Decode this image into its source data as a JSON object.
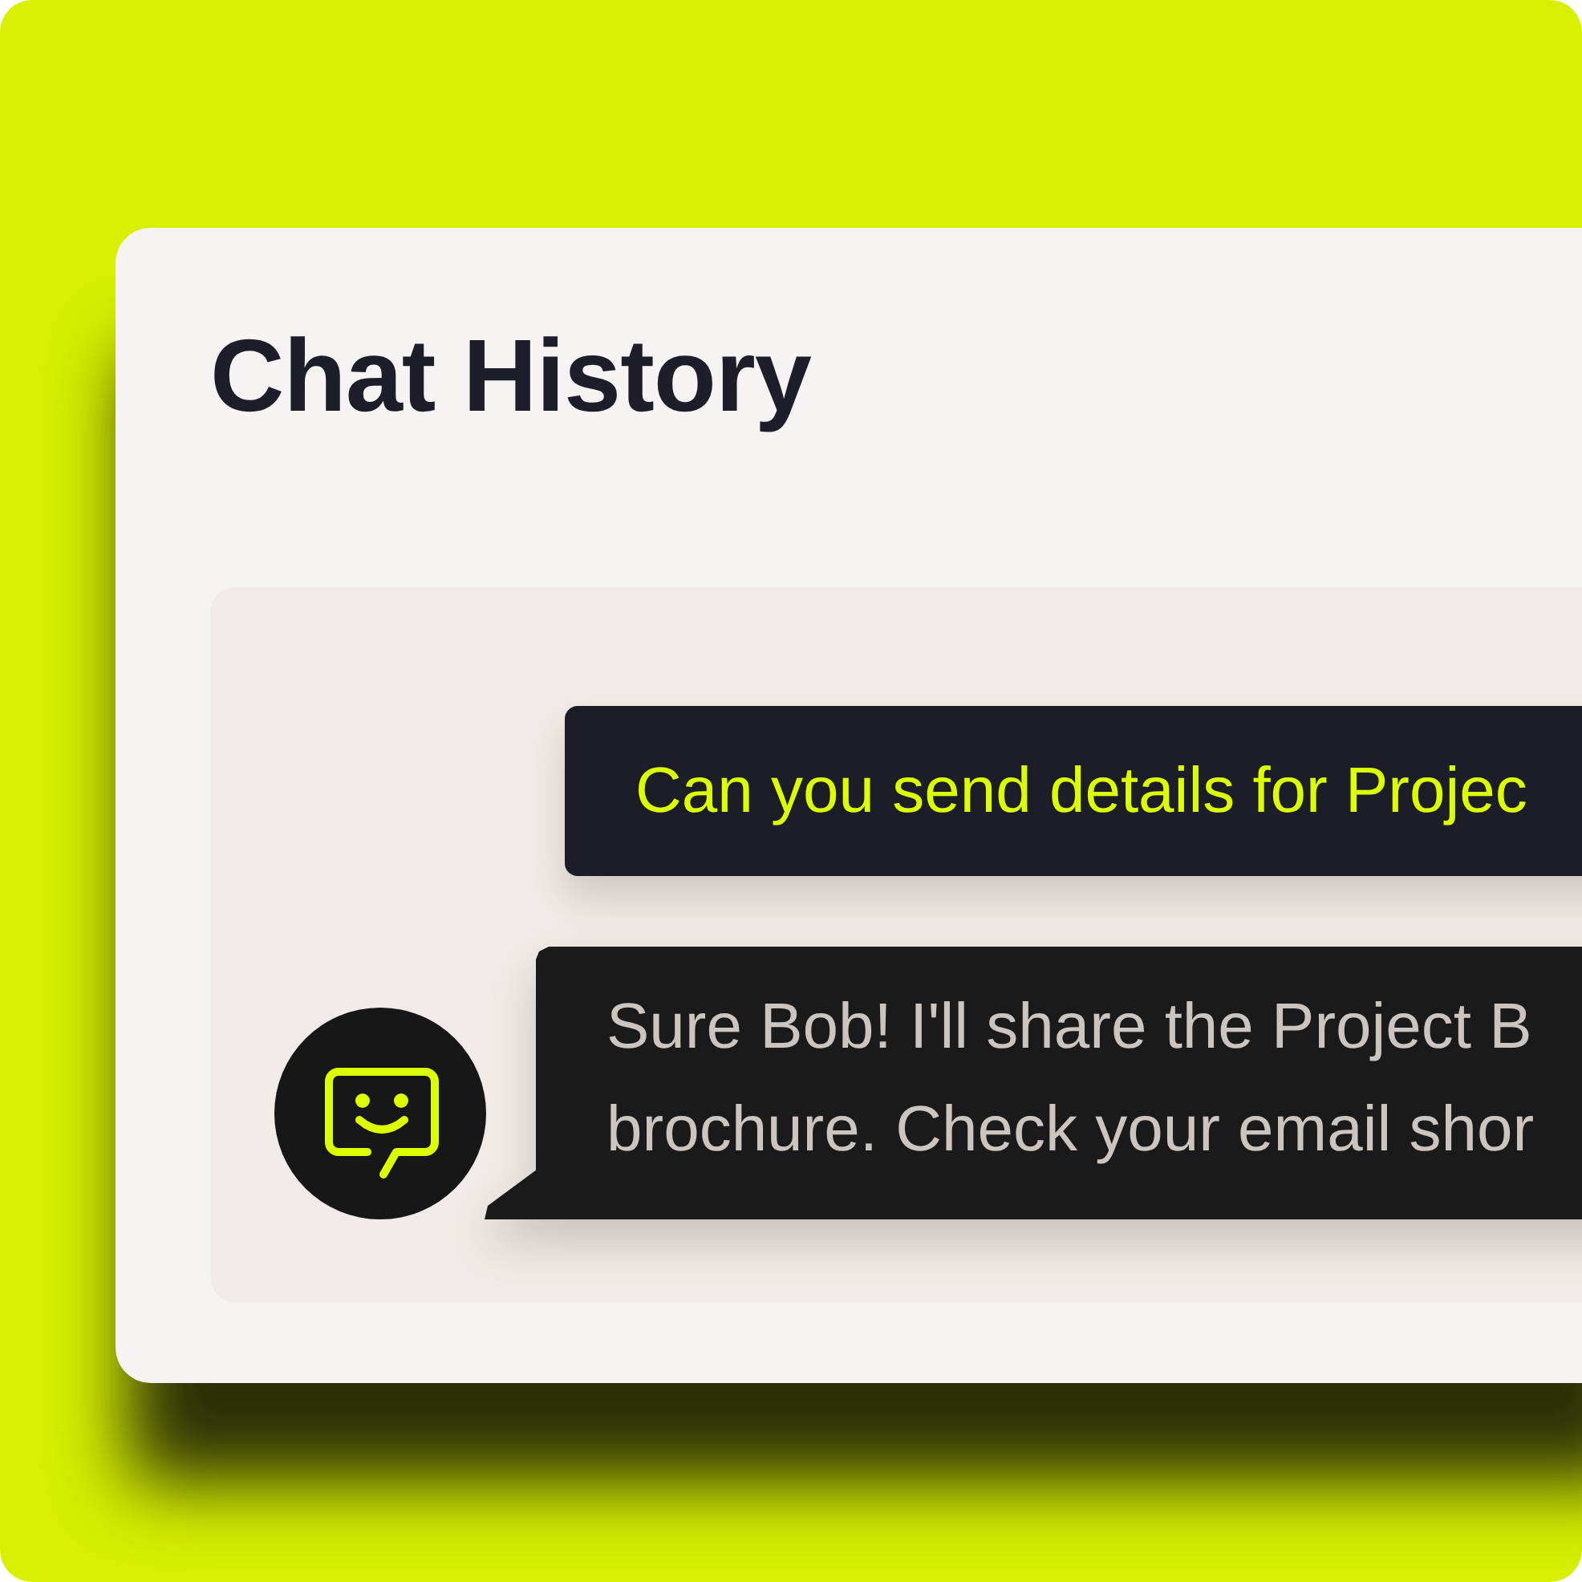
{
  "card": {
    "title": "Chat History"
  },
  "messages": [
    {
      "kind": "user",
      "lines": [
        "Can you send details for Projec"
      ]
    },
    {
      "kind": "bot",
      "lines": [
        "Sure Bob! I'll share the Project B",
        "brochure. Check your email shor"
      ]
    }
  ]
}
